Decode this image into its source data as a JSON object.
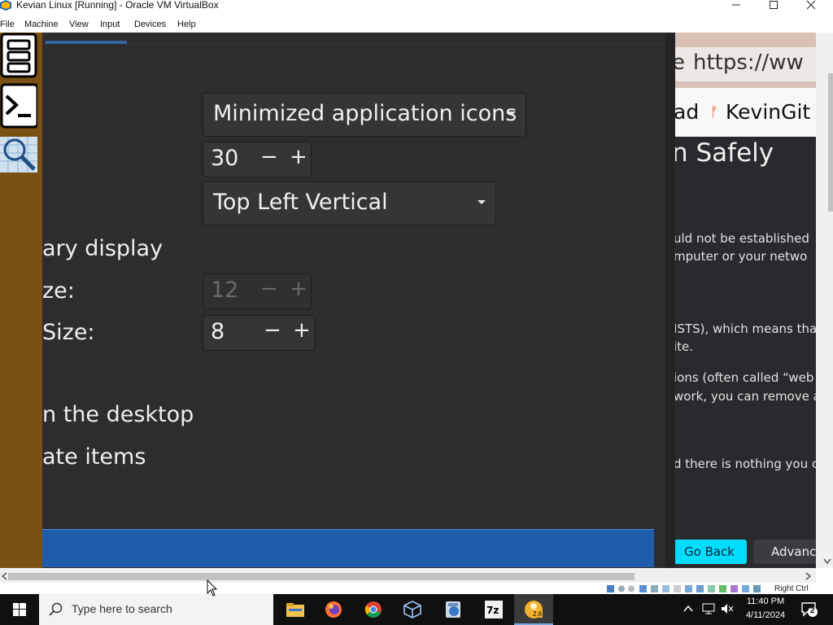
{
  "window": {
    "title": "Kevian Linux [Running] - Oracle VM VirtualBox"
  },
  "menubar": {
    "items": [
      "File",
      "Machine",
      "View",
      "Input",
      "Devices",
      "Help"
    ]
  },
  "settings": {
    "combo_minimized": "Minimized application icons",
    "spin_size": "30",
    "combo_position": "Top Left Vertical",
    "label_primary_display": "ary display",
    "label_size1": "ze:",
    "spin_disabled": "12",
    "label_size2": "Size:",
    "spin_small": "8",
    "label_desktop": "n the desktop",
    "label_items": "ate items",
    "spin_minus": "−",
    "spin_plus": "+"
  },
  "browser": {
    "url_prefix": "e",
    "url": "https://ww",
    "bookmark_left": "ad",
    "bookmark_right": "KevinGit",
    "heading": "n Safely",
    "para": [
      "uld not be established",
      "mputer or your netwo",
      "ISTS), which means that",
      "ite.",
      "ions (often called “web",
      "work, you can remove an",
      "d there is nothing you ca"
    ],
    "go_back": "Go Back",
    "advanced": "Advanc"
  },
  "vbox_status": {
    "host_key": "Right Ctrl"
  },
  "taskbar": {
    "search_placeholder": "Type here to search",
    "time": "11:40 PM",
    "date": "4/11/2024",
    "notification_count": "2",
    "active_app_badge": "2.6"
  },
  "colors": {
    "dock": "#7b5013",
    "settings_bg": "#2d2d2d",
    "accent_blue": "#1f5daa",
    "go_back": "#00ddff",
    "taskbar": "#101010"
  }
}
